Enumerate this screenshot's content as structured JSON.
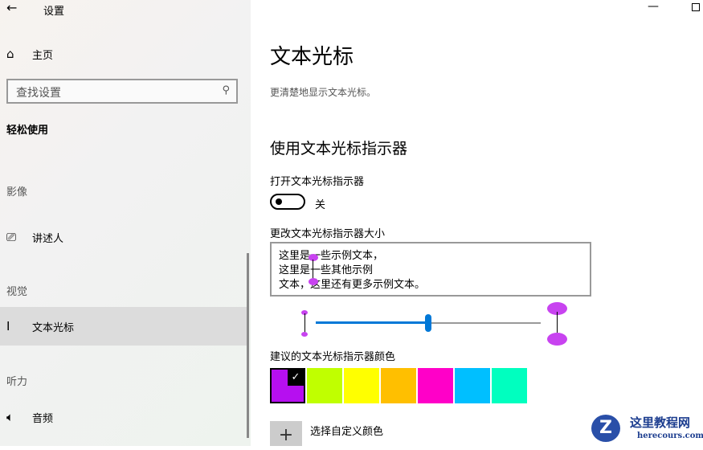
{
  "window": {
    "title": "设置",
    "back_icon": "arrow-left-icon",
    "minimize_icon": "minimize-icon",
    "maximize_icon": "maximize-icon"
  },
  "sidebar": {
    "home": "主页",
    "search_placeholder": "查找设置",
    "category": "轻松使用",
    "groups": [
      "影像",
      "视觉",
      "听力"
    ],
    "items": [
      {
        "label": "讲述人",
        "icon": "narrator-icon"
      },
      {
        "label": "文本光标",
        "icon": "text-cursor-icon",
        "selected": true
      },
      {
        "label": "音频",
        "icon": "speaker-icon"
      }
    ]
  },
  "main": {
    "title": "文本光标",
    "subtitle": "更清楚地显示文本光标。",
    "section": "使用文本光标指示器",
    "toggle_label": "打开文本光标指示器",
    "toggle_state": "关",
    "size_label": "更改文本光标指示器大小",
    "preview_lines": [
      "这里是一些示例文本，",
      "这里是一些其他示例",
      "文本，这里还有更多示例文本。"
    ],
    "size_slider_fraction": 0.5,
    "colors_label": "建议的文本光标指示器颜色",
    "colors": [
      "#b60ff0",
      "#c0ff00",
      "#ffff00",
      "#ffbf00",
      "#ff00c8",
      "#00bfff",
      "#00ffbf"
    ],
    "selected_color_index": 0,
    "custom_color": "选择自定义颜色",
    "accent": "#0078d7"
  },
  "watermark": {
    "name": "这里教程网",
    "url": "herecours.com"
  }
}
